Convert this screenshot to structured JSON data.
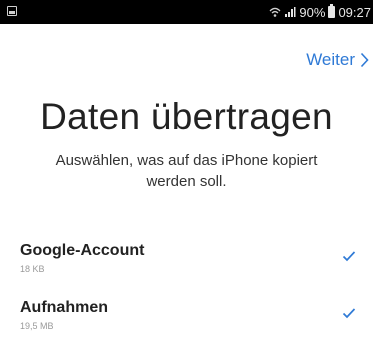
{
  "status_bar": {
    "battery_percent": "90%",
    "time": "09:27",
    "icons": [
      "notification-icon",
      "wifi-icon",
      "signal-icon",
      "battery-icon"
    ]
  },
  "header": {
    "next_label": "Weiter"
  },
  "main": {
    "title": "Daten übertragen",
    "subtitle": "Auswählen, was auf das iPhone kopiert werden soll.",
    "items": [
      {
        "name": "Google-Account",
        "size": "18 KB",
        "checked": true
      },
      {
        "name": "Aufnahmen",
        "size": "19,5 MB",
        "checked": true
      }
    ]
  },
  "colors": {
    "accent": "#2f7ad6",
    "status_bar_bg": "#000000"
  }
}
